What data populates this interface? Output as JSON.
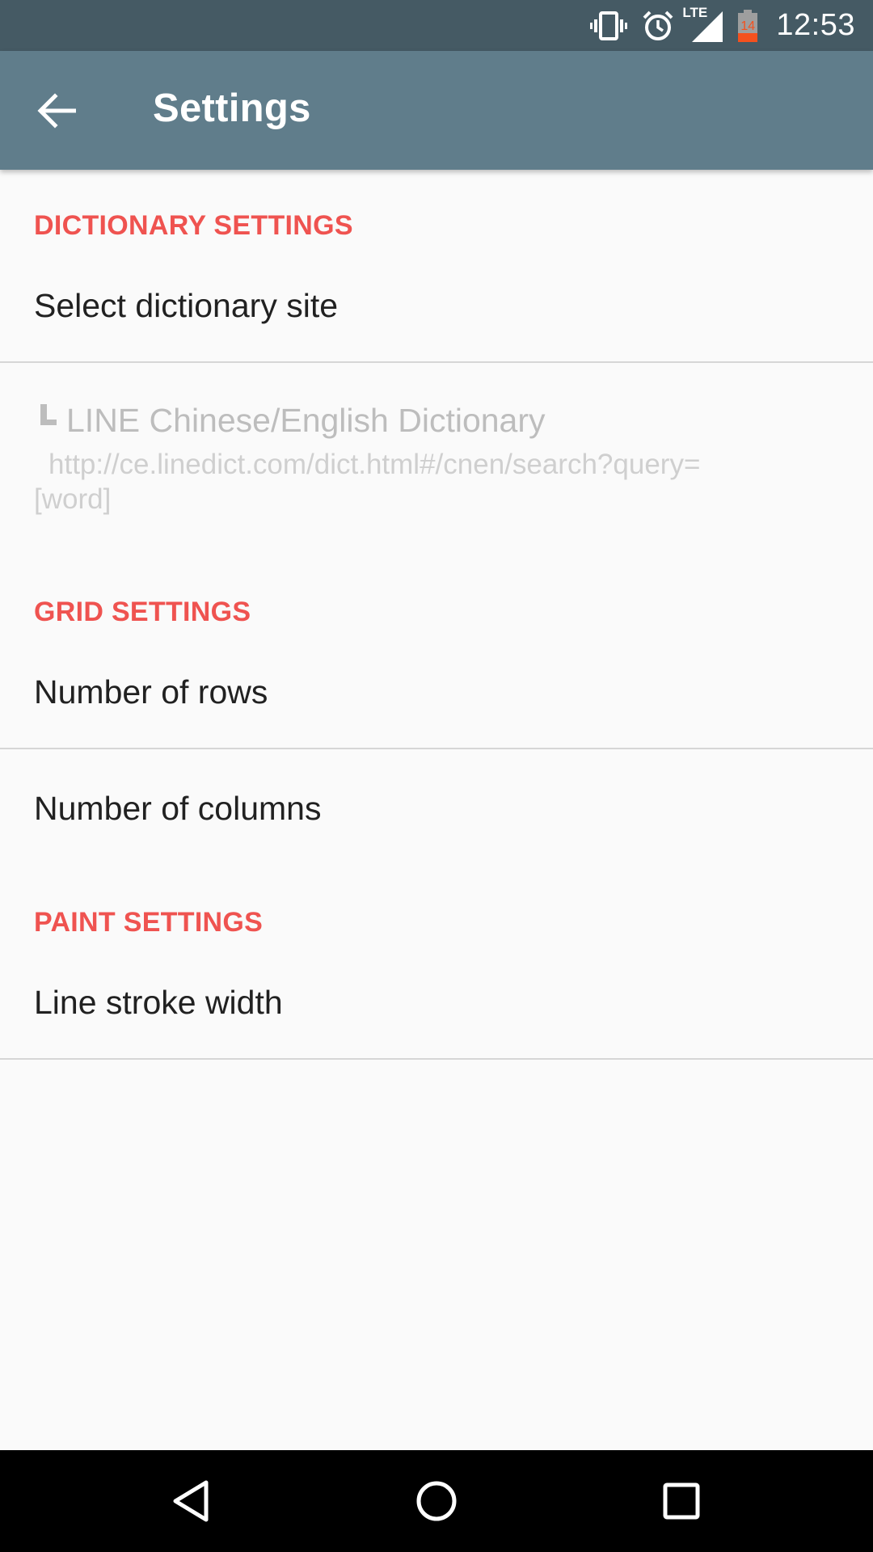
{
  "status_bar": {
    "time": "12:53",
    "network": "LTE",
    "battery_level": "14",
    "icons": [
      "vibrate-icon",
      "alarm-icon",
      "signal-icon",
      "battery-icon"
    ]
  },
  "app_bar": {
    "title": "Settings",
    "back_icon": "arrow-left-icon"
  },
  "sections": {
    "dictionary": {
      "header": "DICTIONARY SETTINGS",
      "select_site_label": "Select dictionary site",
      "selected_site_title": "LINE Chinese/English Dictionary",
      "selected_site_url": "http://ce.linedict.com/dict.html#/cnen/search?query=[word]"
    },
    "grid": {
      "header": "GRID SETTINGS",
      "rows_label": "Number of rows",
      "columns_label": "Number of columns"
    },
    "paint": {
      "header": "PAINT SETTINGS",
      "stroke_label": "Line stroke width"
    }
  },
  "nav_bar": {
    "buttons": [
      "back-icon",
      "home-icon",
      "recents-icon"
    ]
  },
  "colors": {
    "status_bar": "#455a64",
    "app_bar": "#607d8b",
    "accent": "#ef5350",
    "background": "#fafafa"
  }
}
